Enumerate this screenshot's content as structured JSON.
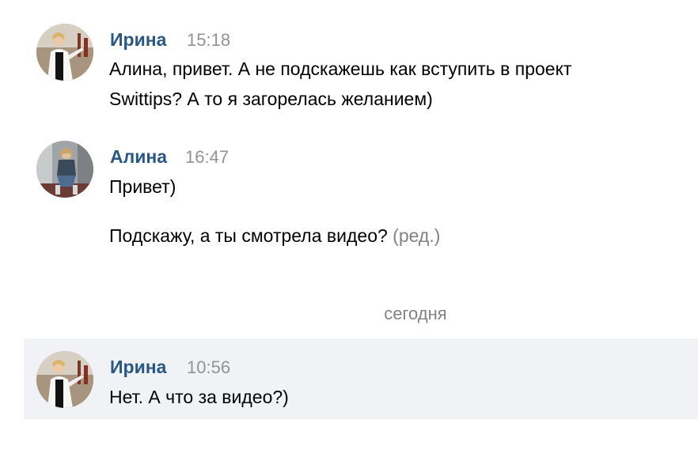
{
  "messages": [
    {
      "author": "Ирина",
      "time": "15:18",
      "avatar": "avatar-irina",
      "lines": [
        "Алина, привет. А не подскажешь как вступить в проект",
        "Swittips? А то я загорелась желанием)"
      ]
    },
    {
      "author": "Алина",
      "time": "16:47",
      "avatar": "avatar-alina",
      "lines": [
        "Привет)",
        "Подскажу, а ты смотрела видео?"
      ],
      "edited_label": "(ред.)"
    },
    {
      "author": "Ирина",
      "time": "10:56",
      "avatar": "avatar-irina",
      "lines": [
        "Нет. А что за видео?)"
      ],
      "highlighted": true
    }
  ],
  "date_divider": "сегодня",
  "colors": {
    "author": "#2a5885",
    "time": "#939393",
    "highlight_bg": "#f0f2f5",
    "text": "#000000"
  }
}
